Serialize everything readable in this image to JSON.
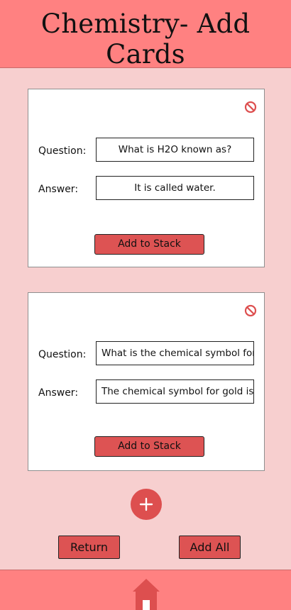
{
  "header": {
    "title": "Chemistry- Add Cards"
  },
  "cards": [
    {
      "question_label": "Question:",
      "question_value": "What is H2O known as?",
      "answer_label": "Answer:",
      "answer_value": "It is called water.",
      "add_button": "Add to Stack"
    },
    {
      "question_label": "Question:",
      "question_value": "What is the chemical symbol for",
      "answer_label": "Answer:",
      "answer_value": "The chemical symbol for gold is",
      "add_button": "Add to Stack"
    }
  ],
  "actions": {
    "return_label": "Return",
    "add_all_label": "Add All"
  },
  "icons": {
    "delete": "no-entry-icon",
    "add": "plus-icon",
    "home": "home-icon"
  },
  "colors": {
    "header": "#ff8181",
    "background": "#f7cfcf",
    "button": "#dd5353",
    "accent": "#dd4f4f"
  }
}
